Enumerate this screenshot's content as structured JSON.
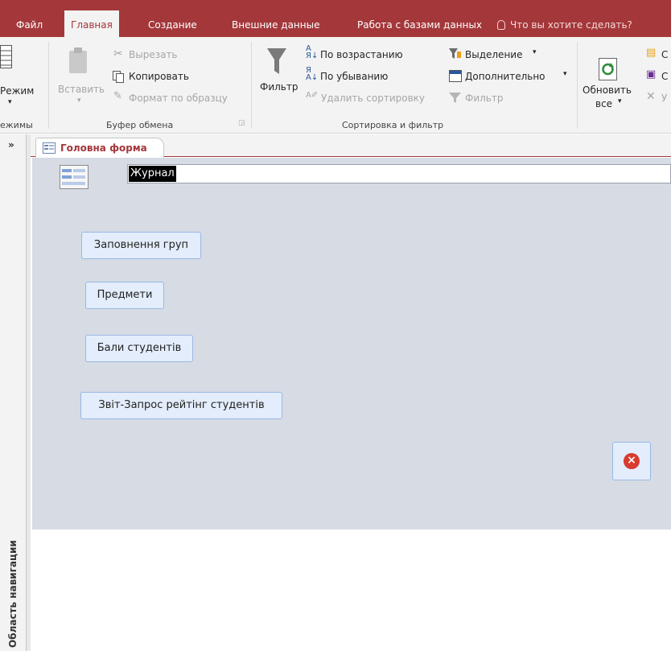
{
  "ribbon": {
    "tabs": [
      "Файл",
      "Главная",
      "Создание",
      "Внешние данные",
      "Работа с базами данных"
    ],
    "active_tab": "Главная",
    "tell_me": "Что вы хотите сделать?",
    "views": {
      "mode_label": "Режим",
      "group_label": "ежимы"
    },
    "clipboard": {
      "paste_label": "Вставить",
      "cut_label": "Вырезать",
      "copy_label": "Копировать",
      "format_painter_label": "Формат по образцу",
      "group_label": "Буфер обмена"
    },
    "sort_filter": {
      "filter_label": "Фильтр",
      "ascending_label": "По возрастанию",
      "descending_label": "По убыванию",
      "remove_sort_label": "Удалить сортировку",
      "selection_label": "Выделение",
      "advanced_label": "Дополнительно",
      "toggle_filter_label": "Фильтр",
      "group_label": "Сортировка и фильтр"
    },
    "records": {
      "refresh_line1": "Обновить",
      "refresh_line2": "все",
      "partial_1": "С",
      "partial_2": "С",
      "partial_3": "У"
    }
  },
  "nav_pane": {
    "toggle": "»",
    "label": "Область навигации"
  },
  "document": {
    "tab_label": "Головна форма",
    "title_value": "Журнал",
    "buttons": [
      "Заповнення груп",
      "Предмети",
      "Бали студентів",
      "Звіт-Запрос рейтінг студентів"
    ],
    "close_icon": "close-circle-icon"
  },
  "colors": {
    "accent": "#a4373a",
    "form_bg": "#d6dbe4",
    "button_bg": "#e3edfb"
  }
}
